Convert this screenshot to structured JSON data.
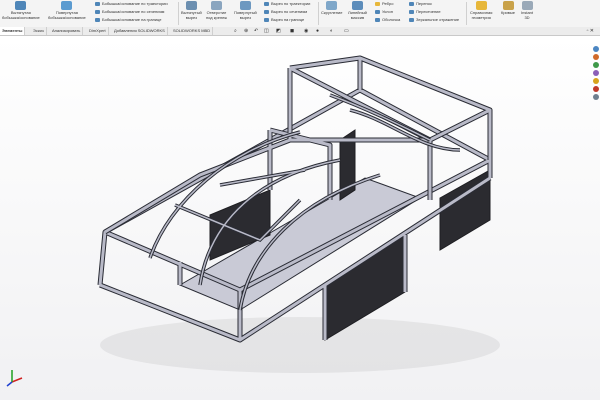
{
  "ribbon": {
    "extrude_boss": "Вытянутая\nбобышка/основание",
    "revolve_boss": "Повернутая\nбобышка/основание",
    "sweep_boss": "Бобышка/основание по траектории",
    "loft_boss": "Бобышка/основание по сечениям",
    "boundary_boss": "Бобышка/основание на границе",
    "extrude_cut": "Вытянутый\nвырез",
    "hole_wizard": "Отверстие\nпод крепеж",
    "revolve_cut": "Повернутый\nвырез",
    "sweep_cut": "Вырез по траектории",
    "loft_cut": "Вырез по сечениям",
    "boundary_cut": "Вырез на границе",
    "fillet": "Скругление",
    "linear_pattern": "Линейный\nмассив",
    "rib": "Ребро",
    "draft": "Уклон",
    "shell": "Оболочка",
    "wrap": "Перенос",
    "intersect": "Пересечение",
    "mirror": "Зеркальное отражение",
    "ref_geometry": "Справочная\nгеометрия",
    "curves": "Кривые",
    "instant3d": "Instant\n3D"
  },
  "tabs": [
    "Элементы",
    "Эскиз",
    "Анализировать",
    "DimXpert",
    "Добавления SOLIDWORKS",
    "SOLIDWORKS MBD"
  ],
  "active_tab": "Элементы",
  "hud_icons": [
    "search-view-icon",
    "zoom-icon",
    "previous-view-icon",
    "section-view-icon",
    "view-orientation-icon",
    "display-style-icon",
    "hide-show-icon",
    "appearance-icon",
    "scene-icon",
    "view-settings-icon"
  ],
  "colors": {
    "frame_stroke": "#2a2c35",
    "frame_fill": "#b9bac8",
    "panel_dark": "#2b2b30",
    "floor": "#c9cad6",
    "ribbon_icon_blue": "#4f86b8",
    "ribbon_icon_yellow": "#e7b73a"
  }
}
